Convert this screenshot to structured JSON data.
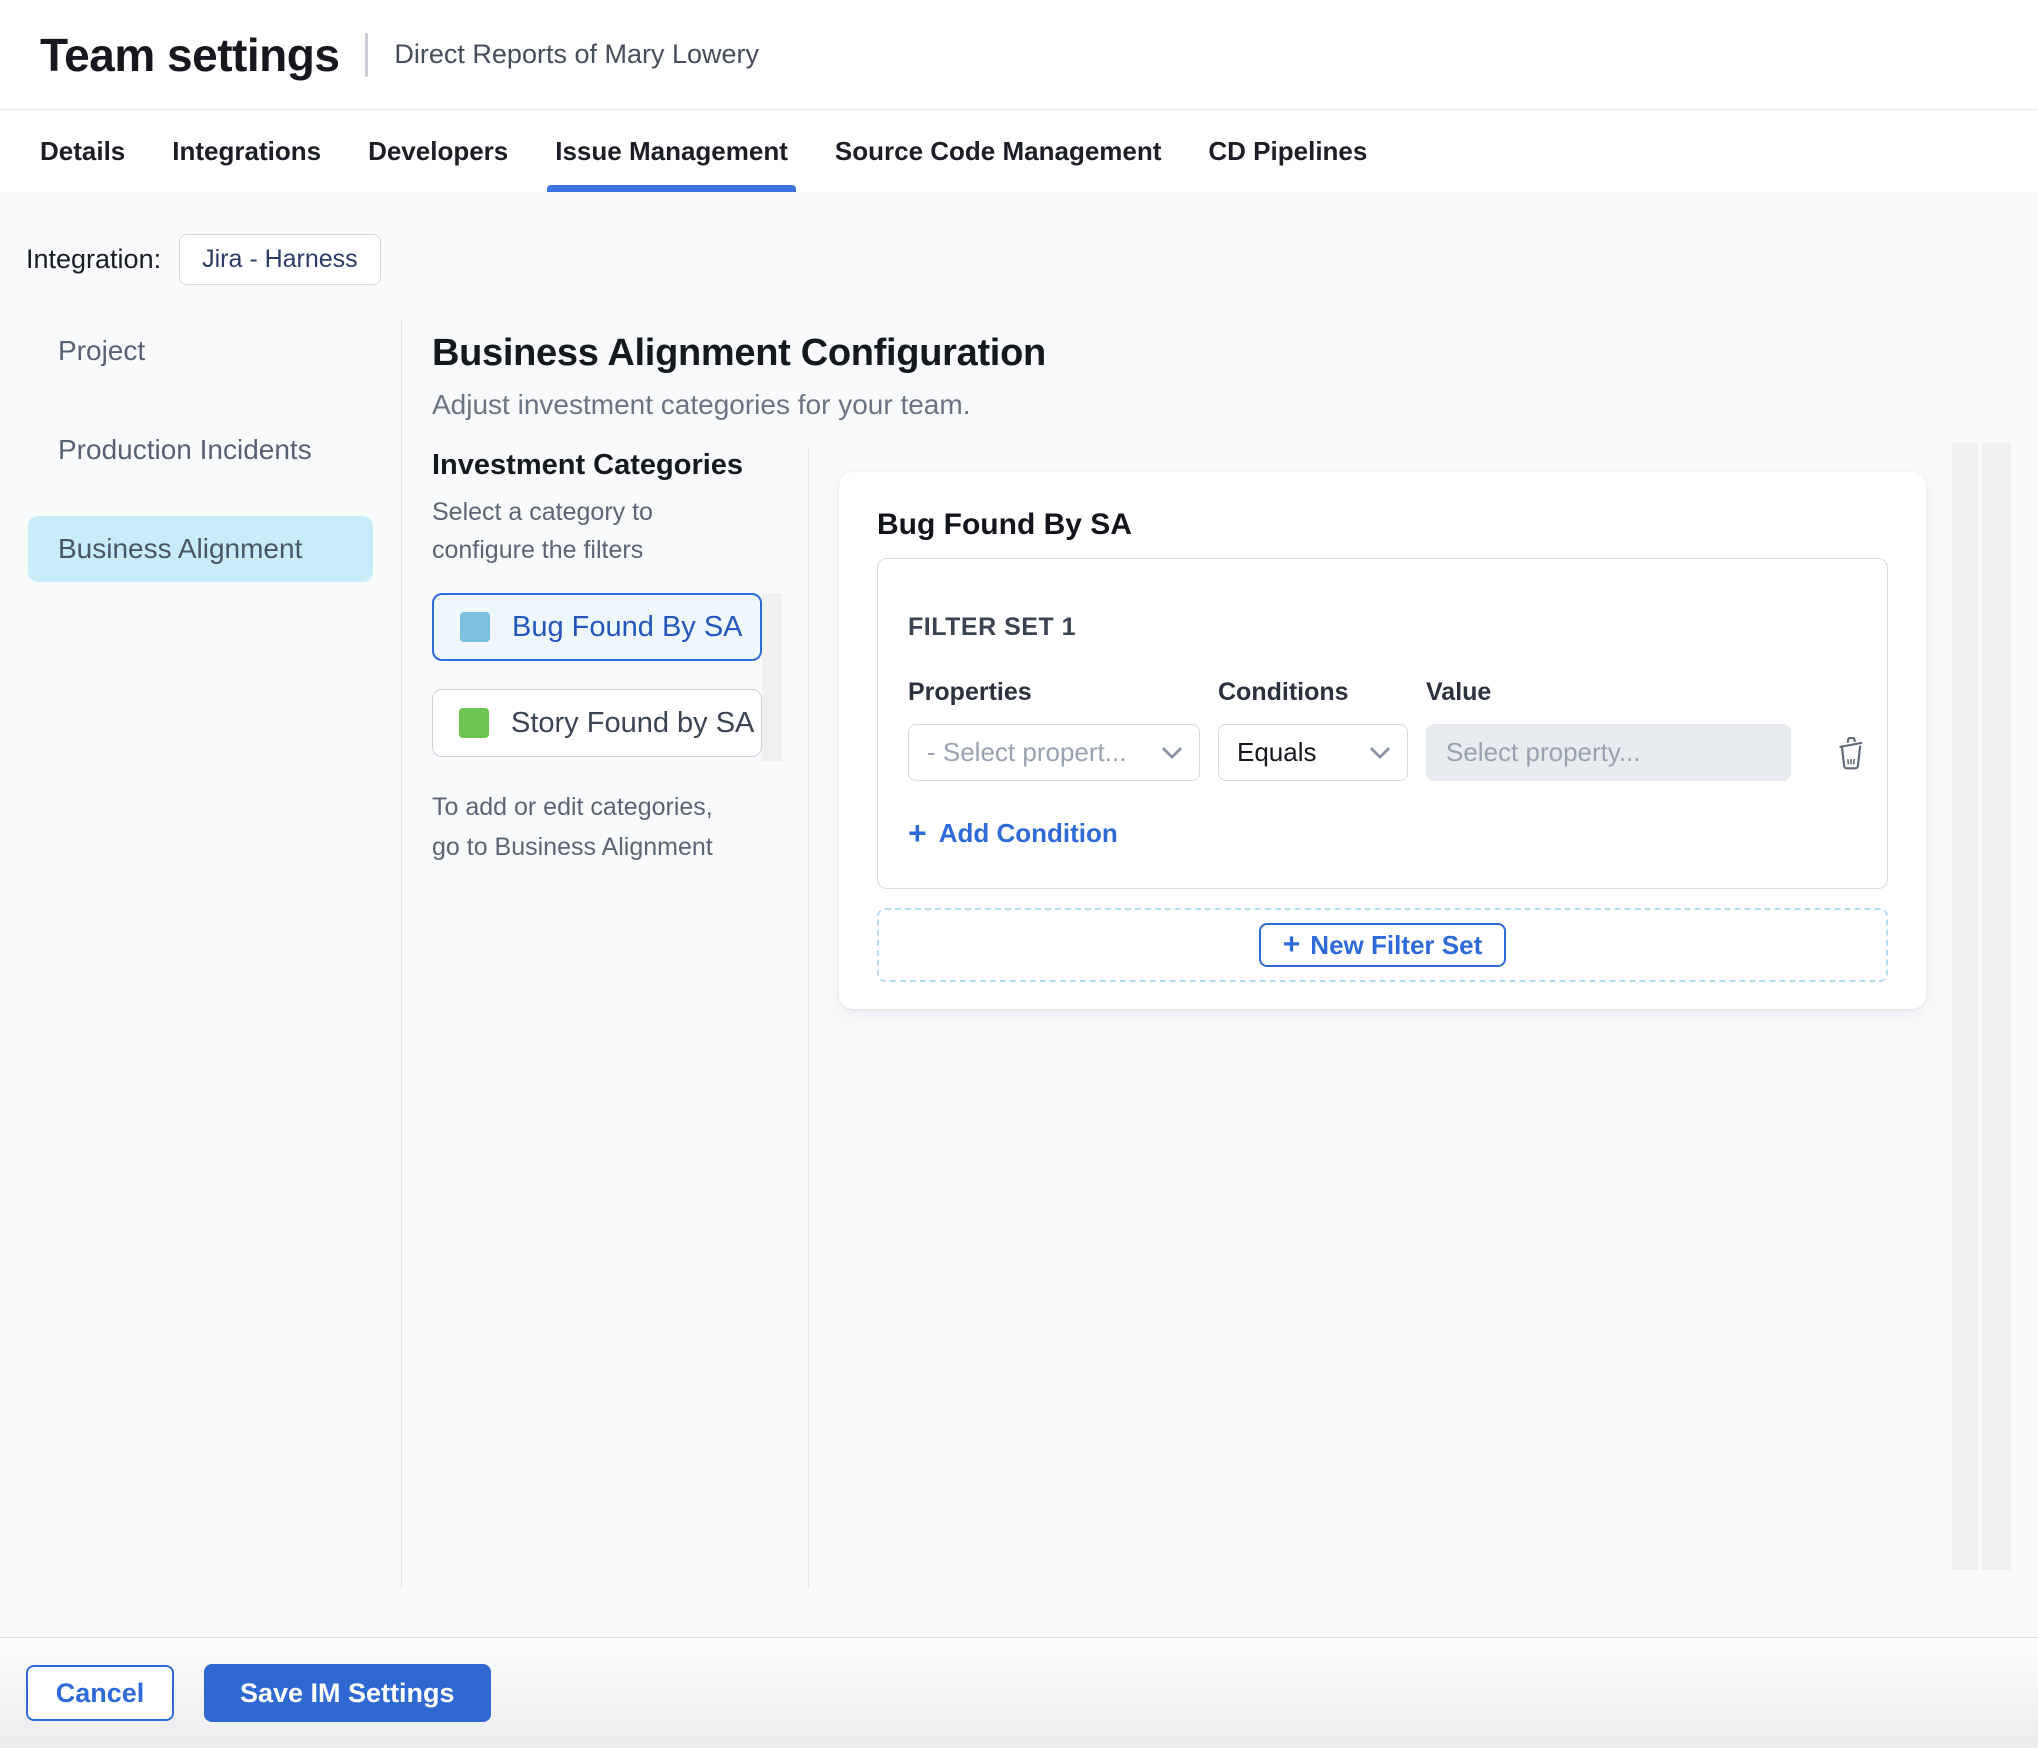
{
  "header": {
    "title": "Team settings",
    "subtitle": "Direct Reports of Mary Lowery"
  },
  "tabs": [
    {
      "label": "Details",
      "active": false
    },
    {
      "label": "Integrations",
      "active": false
    },
    {
      "label": "Developers",
      "active": false
    },
    {
      "label": "Issue Management",
      "active": true
    },
    {
      "label": "Source Code Management",
      "active": false
    },
    {
      "label": "CD Pipelines",
      "active": false
    }
  ],
  "integration": {
    "label": "Integration:",
    "value": "Jira - Harness"
  },
  "sidebar": {
    "items": [
      {
        "label": "Project",
        "selected": false
      },
      {
        "label": "Production Incidents",
        "selected": false
      },
      {
        "label": "Business Alignment",
        "selected": true
      }
    ]
  },
  "main": {
    "heading": "Business Alignment Configuration",
    "subheading": "Adjust investment categories for your team.",
    "categories_panel": {
      "title": "Investment Categories",
      "hint": "Select a category to configure the filters",
      "items": [
        {
          "label": "Bug Found By SA",
          "swatch_color": "#7cc0e0",
          "selected": true
        },
        {
          "label": "Story Found by SA",
          "swatch_color": "#6cc452",
          "selected": false
        }
      ],
      "footnote": "To add or edit categories, go to Business Alignment"
    },
    "config_card": {
      "title": "Bug Found By SA",
      "filter_set": {
        "title": "FILTER SET 1",
        "columns": {
          "properties": "Properties",
          "conditions": "Conditions",
          "value": "Value"
        },
        "row": {
          "property_placeholder": "- Select propert...",
          "condition_value": "Equals",
          "value_placeholder": "Select property..."
        },
        "add_condition_label": "Add Condition",
        "plus_glyph": "+"
      },
      "new_filter_set_label": "New Filter Set"
    }
  },
  "footer": {
    "cancel_label": "Cancel",
    "save_label": "Save IM Settings"
  },
  "colors": {
    "accent_blue": "#2f6bd8",
    "tab_underline": "#3b74dd",
    "selected_nav_bg": "#c8edf9",
    "category_selected_bg": "#edf7fc",
    "bug_swatch": "#7cc0e0",
    "story_swatch": "#6cc452",
    "save_button_bg": "#2e68d0",
    "content_bg": "#f8fafc",
    "value_input_bg": "#e8ecf0"
  }
}
